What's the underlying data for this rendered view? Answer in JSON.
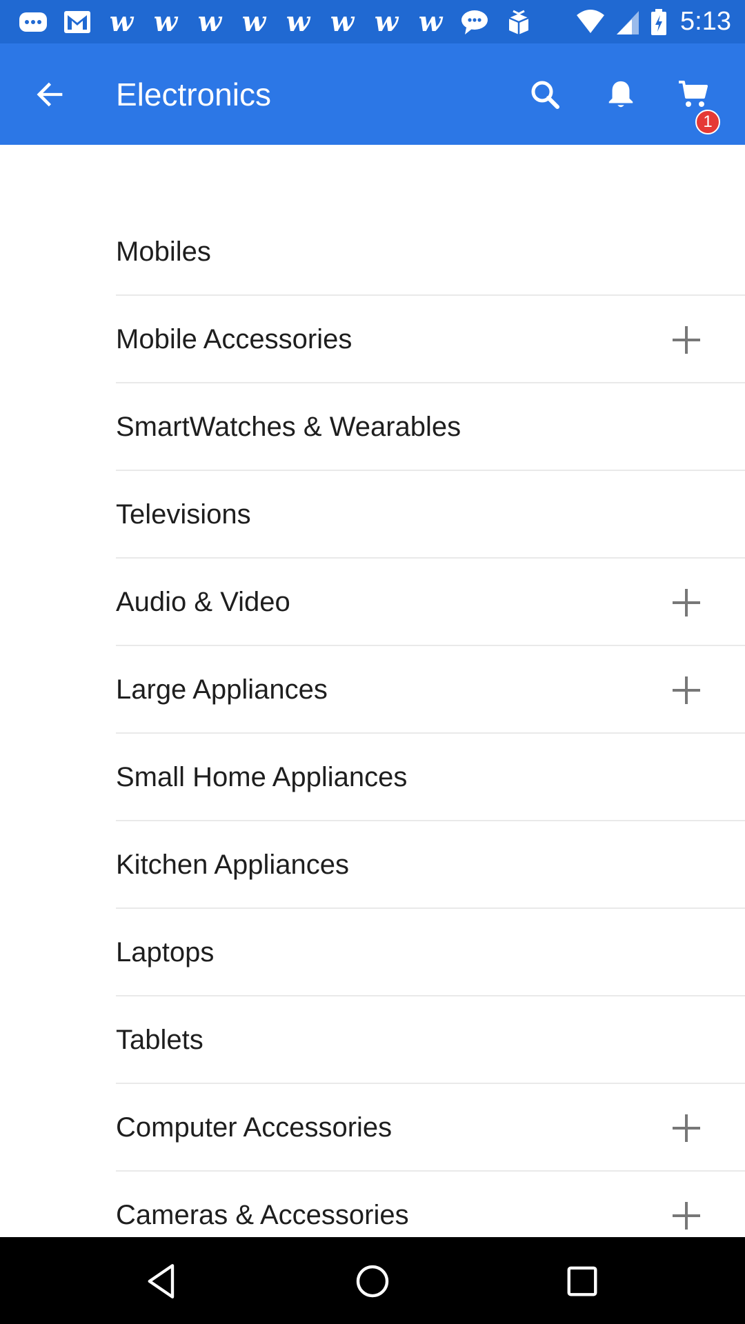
{
  "status_bar": {
    "time": "5:13",
    "notification_icons": [
      "chat-icon",
      "gmail-icon",
      "w",
      "w",
      "w",
      "w",
      "w",
      "w",
      "w",
      "w",
      "message-icon",
      "package-icon"
    ],
    "w_glyph": "w"
  },
  "app_bar": {
    "title": "Electronics",
    "cart_count": "1",
    "accent_color": "#2c77e6",
    "badge_color": "#e53935"
  },
  "categories": [
    {
      "label": "Mobiles",
      "expandable": false
    },
    {
      "label": "Mobile Accessories",
      "expandable": true
    },
    {
      "label": "SmartWatches & Wearables",
      "expandable": false
    },
    {
      "label": "Televisions",
      "expandable": false
    },
    {
      "label": "Audio & Video",
      "expandable": true
    },
    {
      "label": "Large Appliances",
      "expandable": true
    },
    {
      "label": "Small Home Appliances",
      "expandable": false
    },
    {
      "label": "Kitchen Appliances",
      "expandable": false
    },
    {
      "label": "Laptops",
      "expandable": false
    },
    {
      "label": "Tablets",
      "expandable": false
    },
    {
      "label": "Computer Accessories",
      "expandable": true
    },
    {
      "label": "Cameras & Accessories",
      "expandable": true
    }
  ]
}
